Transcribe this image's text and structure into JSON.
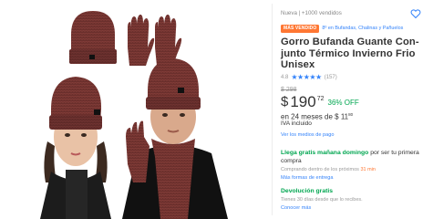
{
  "product": {
    "condition_sold": "Nueva  |  +1000 vendidos",
    "badge": "MÁS VENDIDO",
    "ranking": "8º en Bufandas, Chalinas y Pañuelos",
    "title": "Gorro Bufanda Guante Con-junto Térmico Invierno Frio Unisex",
    "rating_score": "4.8",
    "stars": "★★★★★",
    "rating_count": "(157)",
    "old_price": "$ 298",
    "price_symbol": "$",
    "price_integer": "190",
    "price_cents": "72",
    "discount": "36% OFF",
    "installments_prefix": "en 24 meses de $ 11",
    "installments_cents": "80",
    "iva": "IVA incluido",
    "payment_link": "Ver los medios de pago"
  },
  "shipping": {
    "highlight": "Llega gratis mañana domingo",
    "rest": " por ser tu primera compra",
    "note_prefix": "Comprando dentro de los próximos ",
    "timer": "31 min",
    "more_link": "Más formas de entrega"
  },
  "returns": {
    "title": "Devolución gratis",
    "note": "Tienes 30 días desde que lo recibes.",
    "link": "Conocer más"
  },
  "colors": {
    "accent": "#3483fa",
    "green": "#00a650",
    "badge": "#ff7733",
    "knit": "#6b2f2c"
  },
  "icons": {
    "favorite": "heart-outline-icon"
  }
}
